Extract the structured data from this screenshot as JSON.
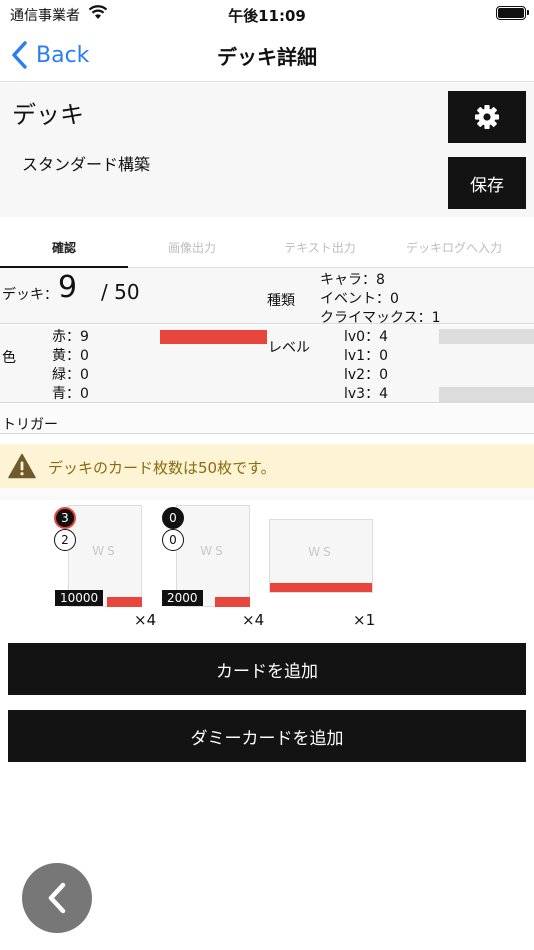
{
  "status_bar": {
    "carrier": "通信事業者",
    "time": "午後11:09"
  },
  "nav": {
    "back_label": "Back",
    "title": "デッキ詳細"
  },
  "header": {
    "deck_name": "デッキ",
    "format": "スタンダード構築",
    "save_label": "保存"
  },
  "tabs": [
    {
      "label": "確認",
      "active": true
    },
    {
      "label": "画像出力",
      "active": false
    },
    {
      "label": "テキスト出力",
      "active": false
    },
    {
      "label": "デッキログへ入力",
      "active": false
    }
  ],
  "summary": {
    "deck_label": "デッキ：",
    "deck_count": "9",
    "deck_max": "/ 50",
    "kind_label": "種類",
    "kinds": [
      "キャラ：8",
      "イベント：0",
      "クライマックス：1"
    ]
  },
  "colors": {
    "label": "色",
    "rows": [
      "赤：9",
      "黄：0",
      "緑：0",
      "青：0"
    ],
    "accent": "#e8463d"
  },
  "levels": {
    "label": "レベル",
    "rows": [
      "lv0：4",
      "lv1：0",
      "lv2：0",
      "lv3：4"
    ]
  },
  "trigger": {
    "label": "トリガー"
  },
  "warning": {
    "text": "デッキのカード枚数は50枚です。"
  },
  "cards": [
    {
      "ws": "WS",
      "level": "3",
      "cost": "2",
      "power": "10000",
      "qty": "×4"
    },
    {
      "ws": "WS",
      "level": "0",
      "cost": "0",
      "power": "2000",
      "qty": "×4"
    },
    {
      "ws": "WS",
      "qty": "×1"
    }
  ],
  "buttons": {
    "add_card": "カードを追加",
    "add_dummy": "ダミーカードを追加"
  }
}
